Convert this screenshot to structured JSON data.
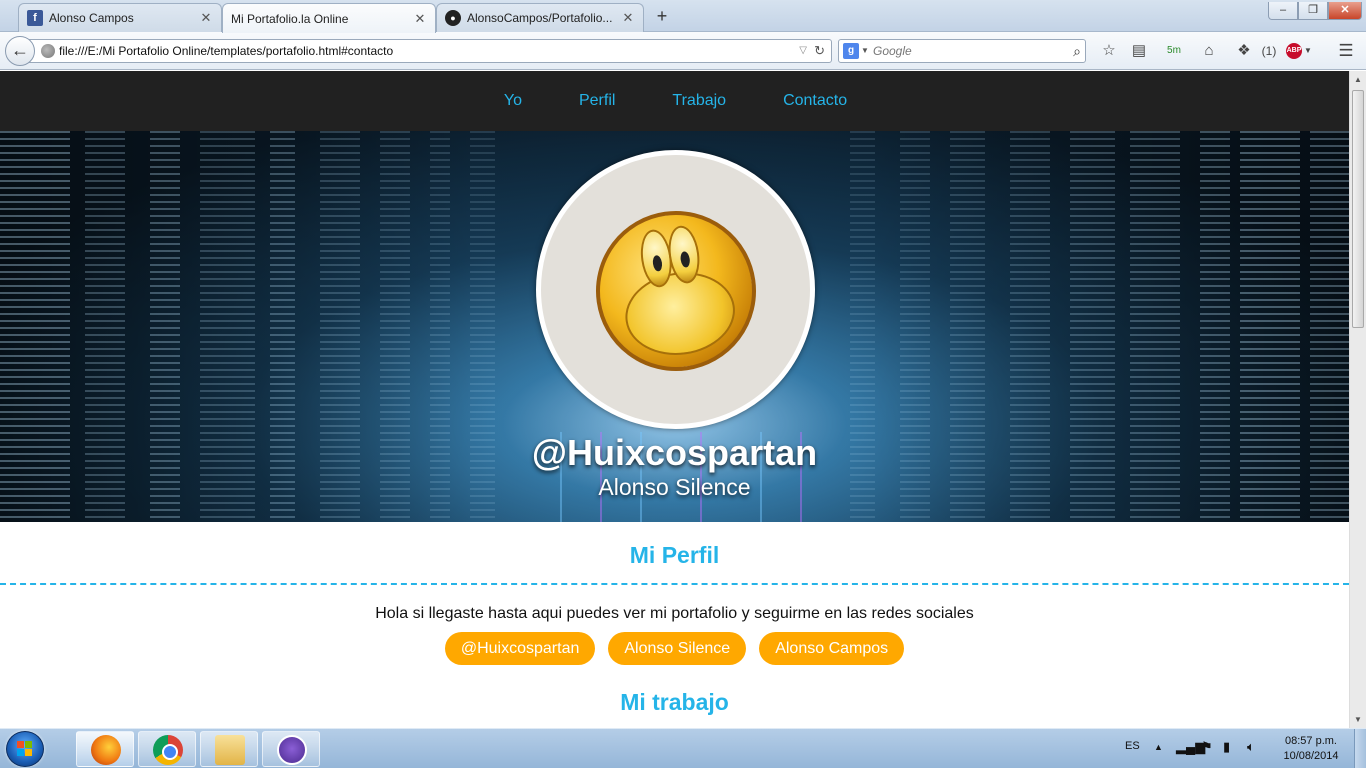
{
  "browser": {
    "tabs": [
      {
        "title": "Alonso Campos",
        "favicon": "facebook-icon",
        "active": false
      },
      {
        "title": "Mi Portafolio.la Online",
        "favicon": "none",
        "active": true
      },
      {
        "title": "AlonsoCampos/Portafolio...",
        "favicon": "github-icon",
        "active": false
      }
    ],
    "new_tab": "+",
    "back": "←",
    "url": "file:///E:/Mi Portafolio Online/templates/portafolio.html#contacto",
    "search_placeholder": "Google",
    "toolbar": {
      "timer": "5m",
      "notification_count": "(1)",
      "abp": "ABP"
    }
  },
  "site": {
    "nav": [
      "Yo",
      "Perfil",
      "Trabajo",
      "Contacto"
    ],
    "handle": "@Huixcospartan",
    "name": "Alonso Silence",
    "perfil_title": "Mi Perfil",
    "intro": "Hola si llegaste hasta aqui puedes ver mi portafolio y seguirme en las redes sociales",
    "social": [
      "@Huixcospartan",
      "Alonso Silence",
      "Alonso Campos"
    ],
    "trabajo_title": "Mi trabajo"
  },
  "taskbar": {
    "apps": [
      "firefox-icon",
      "chrome-icon",
      "file-explorer-icon",
      "cat-app-icon"
    ],
    "language": "ES",
    "time": "08:57 p.m.",
    "date": "10/08/2014"
  },
  "colors": {
    "accent": "#25b4e8",
    "button": "#ffa800",
    "nav_bg": "#212121"
  }
}
